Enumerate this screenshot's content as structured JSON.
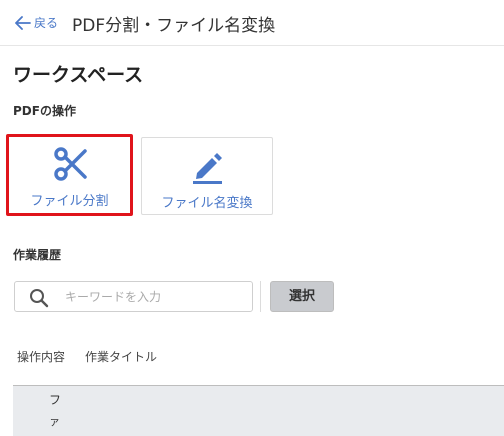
{
  "header": {
    "back_label": "戻る",
    "title": "PDF分割・ファイル名変換"
  },
  "workspace": {
    "title": "ワークスペース"
  },
  "pdf_operations": {
    "section_label": "PDFの操作",
    "cards": [
      {
        "label": "ファイル分割",
        "icon": "scissors-icon",
        "highlighted": true
      },
      {
        "label": "ファイル名変換",
        "icon": "edit-pencil-icon",
        "highlighted": false
      }
    ]
  },
  "history": {
    "section_label": "作業履歴",
    "search": {
      "placeholder": "キーワードを入力",
      "value": ""
    },
    "select_button": "選択",
    "columns": [
      "操作内容",
      "作業タイトル"
    ],
    "rows": [
      {
        "text": "フ"
      },
      {
        "text": "ァ"
      }
    ]
  },
  "colors": {
    "accent": "#4a78c8",
    "highlight_border": "#e0141b",
    "select_button_bg": "#c9cbcf",
    "table_body_bg": "#e9ebee"
  }
}
